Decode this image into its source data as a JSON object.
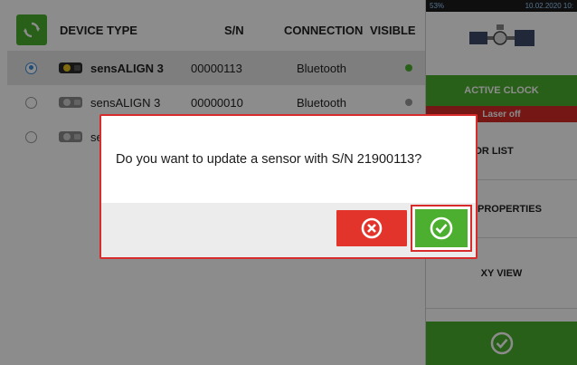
{
  "table": {
    "headers": {
      "device_type": "DEVICE TYPE",
      "sn": "S/N",
      "connection": "CONNECTION",
      "visible": "VISIBLE"
    },
    "rows": [
      {
        "device": "sensALIGN 3",
        "sn": "00000113",
        "connection": "Bluetooth",
        "selected": true,
        "visible_color": "#4caf2f"
      },
      {
        "device": "sensALIGN 3",
        "sn": "00000010",
        "connection": "Bluetooth",
        "selected": false,
        "visible_color": "#9a9a9a"
      },
      {
        "device": "se",
        "sn": "",
        "connection": "",
        "selected": false,
        "visible_color": ""
      }
    ]
  },
  "sidebar": {
    "status_left": "53%",
    "status_right": "10.02.2020 10:",
    "active_clock": "ACTIVE CLOCK",
    "laser": "Laser off",
    "sensor_list": "SOR LIST",
    "properties": "R PROPERTIES",
    "xy_view": "XY VIEW"
  },
  "dialog": {
    "message": "Do you want to update a sensor with S/N 21900113?"
  },
  "colors": {
    "accent_green": "#4caf2f",
    "alert_red": "#d82c2c"
  }
}
